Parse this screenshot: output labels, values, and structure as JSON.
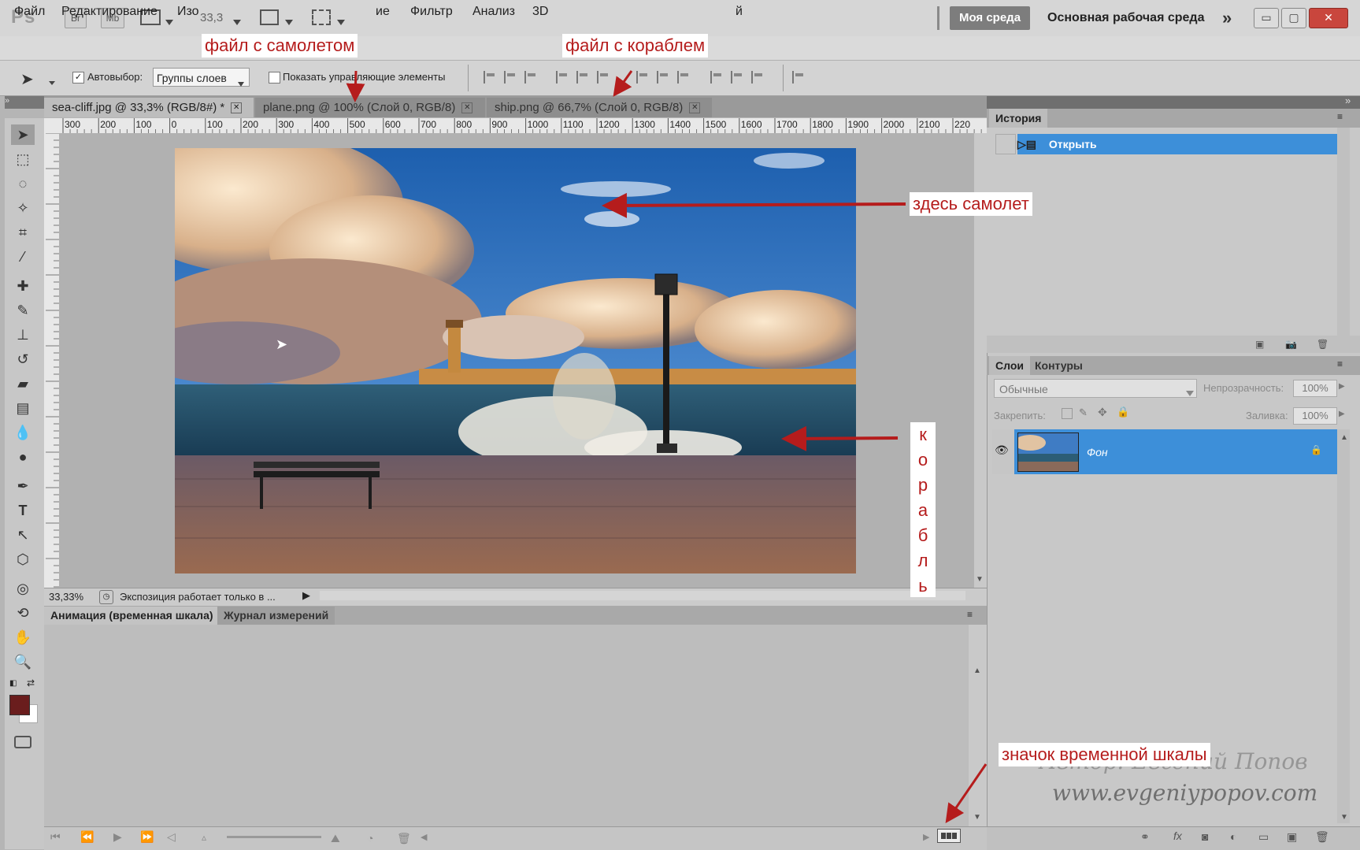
{
  "app": {
    "logo": "Ps",
    "bridge_btn": "Br",
    "minibridge_btn": "Mb",
    "zoom_value": "33,3",
    "workspace_my": "Моя среда",
    "workspace_main": "Основная рабочая среда"
  },
  "menu": [
    "Файл",
    "Редактирование",
    "Изо",
    "ие",
    "Фильтр",
    "Анализ",
    "3D",
    "й"
  ],
  "options": {
    "autoselect_label": "Автовыбор:",
    "autoselect_value": "Группы слоев",
    "show_controls_label": "Показать управляющие элементы"
  },
  "doc_tabs": [
    {
      "label": "sea-cliff.jpg @ 33,3% (RGB/8#) *"
    },
    {
      "label": "plane.png @ 100% (Слой 0, RGB/8)"
    },
    {
      "label": "ship.png @ 66,7% (Слой 0, RGB/8)"
    }
  ],
  "ruler_labels": [
    "300",
    "200",
    "100",
    "0",
    "100",
    "200",
    "300",
    "400",
    "500",
    "600",
    "700",
    "800",
    "900",
    "1000",
    "1100",
    "1200",
    "1300",
    "1400",
    "1500",
    "1600",
    "1700",
    "1800",
    "1900",
    "2000",
    "2100",
    "220"
  ],
  "status": {
    "zoom": "33,33%",
    "message": "Экспозиция работает только в ..."
  },
  "bottom_tabs": [
    "Анимация (временная шкала)",
    "Журнал измерений"
  ],
  "history": {
    "tab": "История",
    "item": "Открыть"
  },
  "layers": {
    "tabs": [
      "Слои",
      "Контуры"
    ],
    "blend_mode": "Обычные",
    "opacity_label": "Непрозрачность:",
    "opacity_value": "100%",
    "lock_label": "Закрепить:",
    "fill_label": "Заливка:",
    "fill_value": "100%",
    "layer_name": "Фон"
  },
  "annotations": {
    "plane_file": "файл с самолетом",
    "ship_file": "файл с  кораблем",
    "plane_here": "здесь самолет",
    "ship_letters": [
      "к",
      "о",
      "р",
      "а",
      "б",
      "л",
      "ь"
    ],
    "timeline_icon": "значок временной шкалы"
  },
  "watermark": {
    "line1": "Автор: Евгений Попов",
    "line2": "www.evgeniypopov.com"
  },
  "colors": {
    "accent": "#3d8fd9",
    "annotation": "#b51c1c",
    "foreground_swatch": "#6a1d1d"
  }
}
